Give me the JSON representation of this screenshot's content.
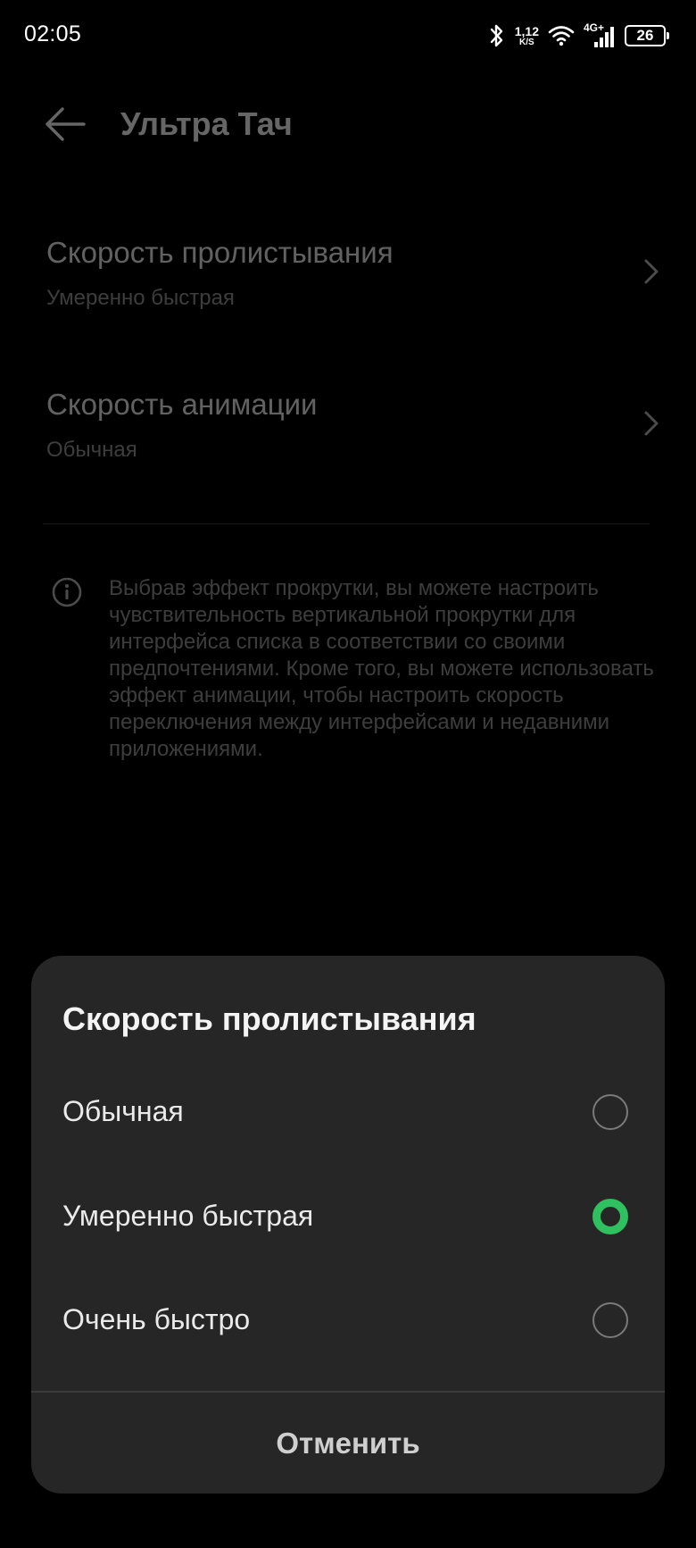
{
  "status_bar": {
    "time": "02:05",
    "net_speed_value": "1,12",
    "net_speed_unit": "K/S",
    "network_type": "4G+",
    "battery": "26"
  },
  "header": {
    "title": "Ультра Тач"
  },
  "settings": [
    {
      "title": "Скорость пролистывания",
      "value": "Умеренно быстрая"
    },
    {
      "title": "Скорость анимации",
      "value": "Обычная"
    }
  ],
  "info": {
    "text": "Выбрав эффект прокрутки, вы можете настроить чувствительность вертикальной прокрутки для интерфейса списка в соответствии со своими предпочтениями. Кроме того, вы можете использовать эффект анимации, чтобы настроить скорость переключения между интерфейсами и недавними приложениями."
  },
  "dialog": {
    "title": "Скорость пролистывания",
    "options": [
      {
        "label": "Обычная",
        "selected": false
      },
      {
        "label": "Умеренно быстрая",
        "selected": true
      },
      {
        "label": "Очень быстро",
        "selected": false
      }
    ],
    "cancel_label": "Отменить"
  },
  "colors": {
    "accent": "#2fc05f",
    "sheet_bg": "#262626",
    "background": "#000000"
  }
}
